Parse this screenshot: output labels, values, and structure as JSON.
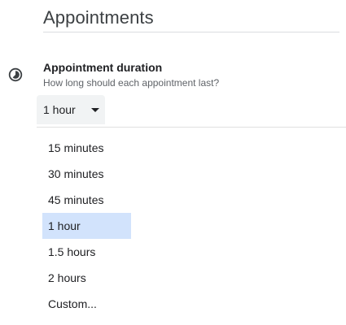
{
  "section": {
    "title": "Appointments"
  },
  "duration": {
    "icon": "timelapse-icon",
    "label": "Appointment duration",
    "description": "How long should each appointment last?",
    "selected_value": "1 hour",
    "selected_bg": "#d2e3fc",
    "options": [
      {
        "label": "15 minutes"
      },
      {
        "label": "30 minutes"
      },
      {
        "label": "45 minutes"
      },
      {
        "label": "1 hour",
        "selected": true
      },
      {
        "label": "1.5 hours"
      },
      {
        "label": "2 hours"
      },
      {
        "label": "Custom..."
      }
    ]
  }
}
